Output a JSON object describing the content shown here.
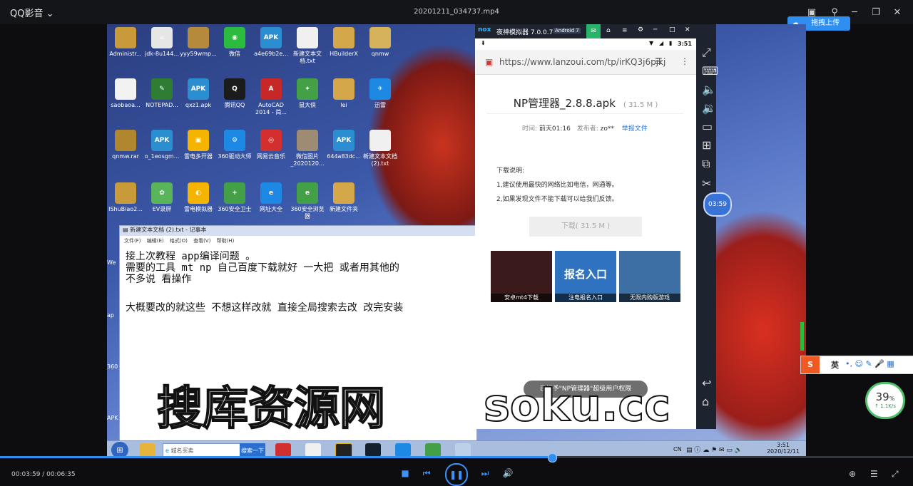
{
  "player": {
    "app_title": "QQ影音",
    "file_title": "20201211_034737.mp4",
    "time_label": "00:03:59 / 00:06:35",
    "progress_fraction": 0.605
  },
  "desktop_icons": [
    {
      "label": "Administr...",
      "color": "#c89a3a",
      "glyph": ""
    },
    {
      "label": "jdk-8u144...",
      "color": "#e6e6e6",
      "glyph": "☕"
    },
    {
      "label": "yyy59wmp...",
      "color": "#b68a3c",
      "glyph": ""
    },
    {
      "label": "微信",
      "color": "#2dbb3f",
      "glyph": "◉"
    },
    {
      "label": "a4e69b2e...",
      "color": "#2a8ed0",
      "glyph": "APK"
    },
    {
      "label": "新建文本文档.txt",
      "color": "#f0f0f0",
      "glyph": ""
    },
    {
      "label": "HBuilderX",
      "color": "#d4a84a",
      "glyph": ""
    },
    {
      "label": "qnmw",
      "color": "#d6b25a",
      "glyph": ""
    },
    {
      "label": "saobaoa...",
      "color": "#f2f2f2",
      "glyph": ""
    },
    {
      "label": "NOTEPAD...",
      "color": "#2e7d32",
      "glyph": "✎"
    },
    {
      "label": "qxz1.apk",
      "color": "#2a8ed0",
      "glyph": "APK"
    },
    {
      "label": "腾讯QQ",
      "color": "#1b1b1b",
      "glyph": "Q"
    },
    {
      "label": "AutoCAD 2014 - 简...",
      "color": "#c62828",
      "glyph": "A"
    },
    {
      "label": "鼠大侠",
      "color": "#43a047",
      "glyph": "✦"
    },
    {
      "label": "lei",
      "color": "#d4a84a",
      "glyph": ""
    },
    {
      "label": "迅雷",
      "color": "#1e88e5",
      "glyph": "✈"
    },
    {
      "label": "qnmw.rar",
      "color": "#b0862f",
      "glyph": ""
    },
    {
      "label": "o_1eosgm...",
      "color": "#2a8ed0",
      "glyph": "APK"
    },
    {
      "label": "雷电多开器",
      "color": "#f5b400",
      "glyph": "▣"
    },
    {
      "label": "360驱动大师",
      "color": "#1e88e5",
      "glyph": "⚙"
    },
    {
      "label": "网易云音乐",
      "color": "#d32f2f",
      "glyph": "◎"
    },
    {
      "label": "微信图片_2020120...",
      "color": "#9e8b74",
      "glyph": ""
    },
    {
      "label": "644a83dc...",
      "color": "#2a8ed0",
      "glyph": "APK"
    },
    {
      "label": "新建文本文档 (2).txt",
      "color": "#f0f0f0",
      "glyph": ""
    },
    {
      "label": "IShuBiao2...",
      "color": "#c89a3a",
      "glyph": ""
    },
    {
      "label": "EV录屏",
      "color": "#5ab55a",
      "glyph": "✿"
    },
    {
      "label": "雷电模拟器",
      "color": "#f5b400",
      "glyph": "◐"
    },
    {
      "label": "360安全卫士",
      "color": "#43a047",
      "glyph": "+"
    },
    {
      "label": "网址大全",
      "color": "#1e88e5",
      "glyph": "e"
    },
    {
      "label": "360安全浏览器",
      "color": "#43a047",
      "glyph": "e"
    },
    {
      "label": "新建文件夹",
      "color": "#d4a84a",
      "glyph": ""
    }
  ],
  "left_partial": [
    "We",
    "ap",
    "360",
    "APK"
  ],
  "notepad": {
    "title": "新建文本文档 (2).txt - 记事本",
    "menu": [
      "文件(F)",
      "编辑(E)",
      "格式(O)",
      "查看(V)",
      "帮助(H)"
    ],
    "lines": [
      "接上次教程   app编译问题 。",
      "需要的工具   mt  np 自己百度下载就好 一大把 或者用其他的",
      "不多说 看操作",
      "大概要改的就这些 不想这样改就 直接全局搜索去改   改完安装"
    ]
  },
  "emulator": {
    "logo": "nox",
    "title": "夜神模拟器 7.0.0.7",
    "android_badge": "Android 7",
    "clock": "3:51",
    "url": "https://www.lanzoui.com/tp/irKQ3j6pjkj",
    "file_name": "NP管理器_2.8.8.apk",
    "file_size": "( 31.5 M )",
    "meta_time_label": "时间:",
    "meta_time": "前天01:16",
    "meta_uploader_label": "发布者:",
    "meta_uploader": "zo**",
    "report_link": "举报文件",
    "notes_title": "下载说明:",
    "note_1": "1,建议使用最快的网络比如电信，网通等。",
    "note_2": "2,如果发现文件不能下载可以给我们反馈。",
    "download_label": "下载( 31.5 M )",
    "thumbs": [
      {
        "caption": "安卓mt4下载",
        "color": "#3a1a1a"
      },
      {
        "caption": "注电报名入口",
        "color": "#2f73c0",
        "big": "报名入口"
      },
      {
        "caption": "无限内购版游戏",
        "color": "#3d6fa5"
      }
    ],
    "toast": "已授予\"NP管理器\"超级用户权限"
  },
  "watermark": {
    "cn": "搜库资源网",
    "en": "soku.cc"
  },
  "taskbar": {
    "search_placeholder": "城名买卖",
    "search_button": "搜索一下",
    "tray_time": "3:51",
    "tray_date": "2020/12/11",
    "lang": "CN"
  },
  "overlays": {
    "upload_label": "拖拽上传",
    "time_bubble": "03:59",
    "ime_label": "英",
    "net_percent": "39",
    "net_percent_unit": "%",
    "net_speed": "↑ 1.1K/s"
  }
}
